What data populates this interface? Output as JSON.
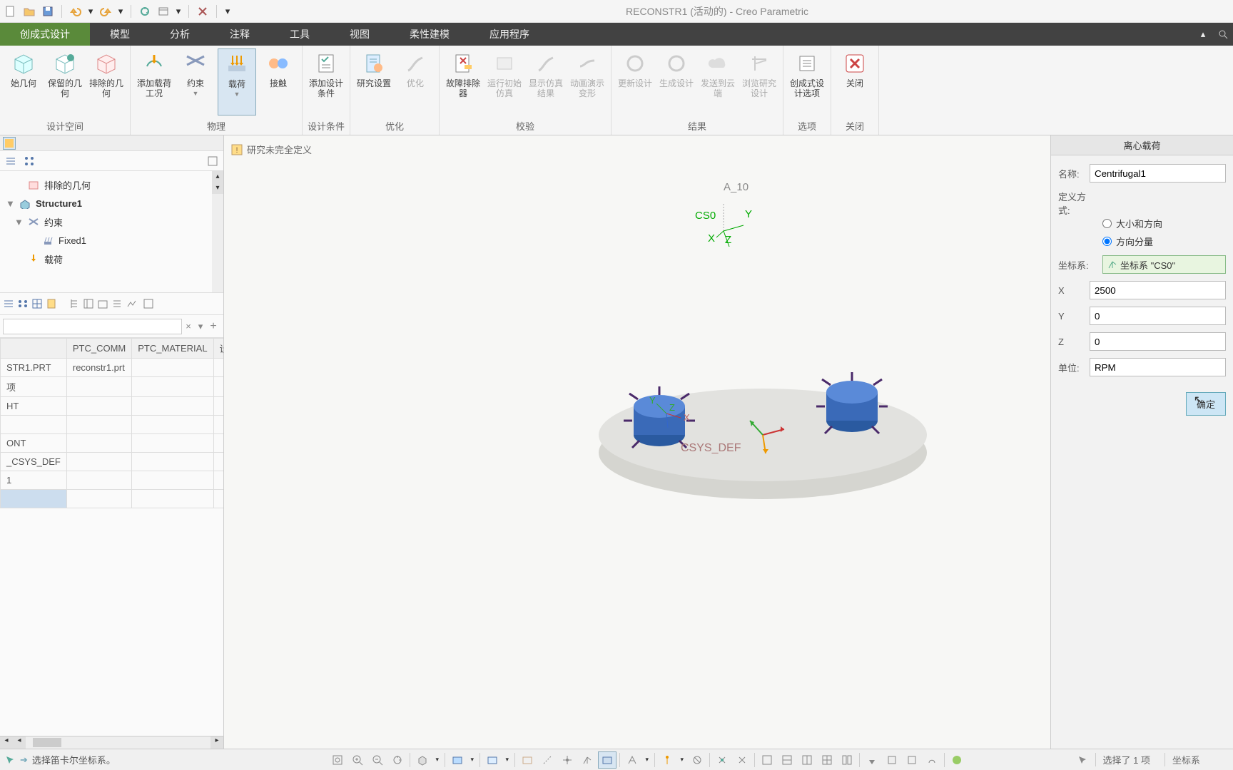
{
  "title": "RECONSTR1 (活动的) - Creo Parametric",
  "tabs": {
    "active": "创成式设计",
    "items": [
      "模型",
      "分析",
      "注释",
      "工具",
      "视图",
      "柔性建模",
      "应用程序"
    ]
  },
  "ribbon": {
    "groups": [
      {
        "label": "设计空间",
        "buttons": [
          {
            "label": "始几何",
            "icon": "cube",
            "dd": false
          },
          {
            "label": "保留的几何",
            "icon": "cube-keep",
            "dd": false
          },
          {
            "label": "排除的几何",
            "icon": "cube-excl",
            "dd": false
          }
        ]
      },
      {
        "label": "物理",
        "buttons": [
          {
            "label": "添加载荷工况",
            "icon": "load-case",
            "dd": false
          },
          {
            "label": "约束",
            "icon": "constraint",
            "dd": true
          },
          {
            "label": "载荷",
            "icon": "load",
            "dd": true,
            "active": true
          },
          {
            "label": "接触",
            "icon": "contact",
            "dd": false
          }
        ]
      },
      {
        "label": "设计条件",
        "buttons": [
          {
            "label": "添加设计条件",
            "icon": "criteria",
            "dd": false
          }
        ]
      },
      {
        "label": "优化",
        "buttons": [
          {
            "label": "研究设置",
            "icon": "study",
            "dd": false
          },
          {
            "label": "优化",
            "icon": "optimize",
            "disabled": true
          }
        ]
      },
      {
        "label": "校验",
        "buttons": [
          {
            "label": "故障排除器",
            "icon": "troubleshoot",
            "dd": false
          },
          {
            "label": "运行初始仿真",
            "icon": "run-sim",
            "disabled": true
          },
          {
            "label": "显示仿真结果",
            "icon": "sim-results",
            "disabled": true
          },
          {
            "label": "动画演示变形",
            "icon": "anim",
            "disabled": true
          }
        ]
      },
      {
        "label": "结果",
        "buttons": [
          {
            "label": "更新设计",
            "icon": "update",
            "disabled": true
          },
          {
            "label": "生成设计",
            "icon": "generate",
            "disabled": true
          },
          {
            "label": "发送到云端",
            "icon": "cloud",
            "disabled": true
          },
          {
            "label": "浏览研究设计",
            "icon": "browse",
            "disabled": true
          }
        ]
      },
      {
        "label": "选项",
        "buttons": [
          {
            "label": "创成式设计选项",
            "icon": "options",
            "dd": false
          }
        ]
      },
      {
        "label": "关闭",
        "buttons": [
          {
            "label": "关闭",
            "icon": "close-x",
            "dd": false
          }
        ]
      }
    ]
  },
  "tree": {
    "items": [
      {
        "label": "排除的几何",
        "icon": "excl",
        "indent": 1
      },
      {
        "label": "Structure1",
        "icon": "struct",
        "indent": 0,
        "exp": "▼",
        "bold": true
      },
      {
        "label": "约束",
        "icon": "constr",
        "indent": 1,
        "exp": "▼"
      },
      {
        "label": "Fixed1",
        "icon": "fixed",
        "indent": 2
      },
      {
        "label": "载荷",
        "icon": "load",
        "indent": 1
      }
    ]
  },
  "grid": {
    "cols": [
      "",
      "PTC_COMM",
      "PTC_MATERIAL",
      "设计"
    ],
    "rows": [
      [
        "STR1.PRT",
        "reconstr1.prt",
        "",
        ""
      ],
      [
        "项",
        "",
        "",
        ""
      ],
      [
        "HT",
        "",
        "",
        ""
      ],
      [
        "",
        "",
        "",
        ""
      ],
      [
        "ONT",
        "",
        "",
        ""
      ],
      [
        "_CSYS_DEF",
        "",
        "",
        ""
      ],
      [
        "1",
        "",
        "",
        ""
      ],
      [
        "",
        "",
        "",
        ""
      ]
    ]
  },
  "canvas": {
    "status": "研究未完全定义",
    "a_label": "A_10",
    "cs_label": "CS0",
    "axes": {
      "x": "X",
      "y": "Y",
      "z": "Z"
    },
    "csys_def": "CSYS_DEF"
  },
  "rightPanel": {
    "title": "离心载荷",
    "nameLabel": "名称:",
    "nameValue": "Centrifugal1",
    "defLabel": "定义方式:",
    "radio1": "大小和方向",
    "radio2": "方向分量",
    "csysLabel": "坐标系:",
    "csysValue": "坐标系 \"CS0\"",
    "xLabel": "X",
    "xValue": "2500",
    "yLabel": "Y",
    "yValue": "0",
    "zLabel": "Z",
    "zValue": "0",
    "unitLabel": "单位:",
    "unitValue": "RPM",
    "ok": "确定"
  },
  "statusbar": {
    "prompt": "选择笛卡尔坐标系。",
    "selection": "选择了 1 项",
    "filter": "坐标系"
  }
}
